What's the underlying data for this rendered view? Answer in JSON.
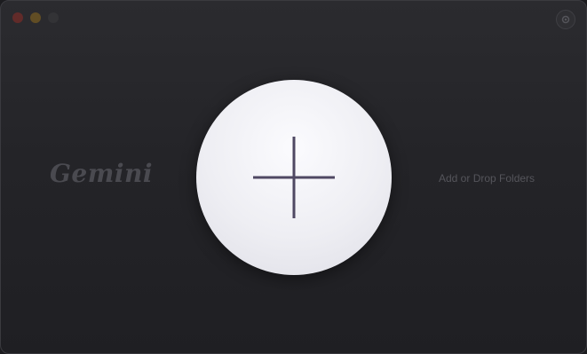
{
  "window": {
    "traffic_lights": [
      "close",
      "minimize",
      "zoom"
    ]
  },
  "toolbar": {
    "settings_icon": "gear-icon"
  },
  "brand": {
    "logo_text": "Gemini"
  },
  "main": {
    "add_button_icon": "plus-icon",
    "hint_text": "Add or Drop Folders"
  },
  "colors": {
    "background": "#242428",
    "circle": "#eeeef3",
    "plus": "#4f4863"
  }
}
